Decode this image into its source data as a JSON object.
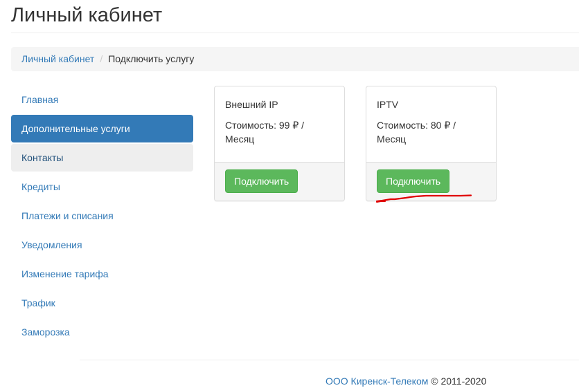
{
  "header": {
    "title": "Личный кабинет"
  },
  "breadcrumb": {
    "home": "Личный кабинет",
    "separator": "/",
    "current": "Подключить услугу"
  },
  "sidebar": {
    "items": [
      {
        "label": "Главная",
        "state": "normal"
      },
      {
        "label": "Дополнительные услуги",
        "state": "active"
      },
      {
        "label": "Контакты",
        "state": "hover"
      },
      {
        "label": "Кредиты",
        "state": "normal"
      },
      {
        "label": "Платежи и списания",
        "state": "normal"
      },
      {
        "label": "Уведомления",
        "state": "normal"
      },
      {
        "label": "Изменение тарифа",
        "state": "normal"
      },
      {
        "label": "Трафик",
        "state": "normal"
      },
      {
        "label": "Заморозка",
        "state": "normal"
      }
    ]
  },
  "services": [
    {
      "name": "Внешний IP",
      "price_line1": "Стоимость: 99 ₽ /",
      "price_line2": "Месяц",
      "button_label": "Подключить"
    },
    {
      "name": "IPTV",
      "price_line1": "Стоимость: 80 ₽ /",
      "price_line2": "Месяц",
      "button_label": "Подключить"
    }
  ],
  "footer": {
    "company": "ООО Киренск-Телеком",
    "copyright": "© 2011-2020"
  },
  "colors": {
    "primary": "#337ab7",
    "success": "#5cb85c",
    "annotation": "#e00000"
  }
}
